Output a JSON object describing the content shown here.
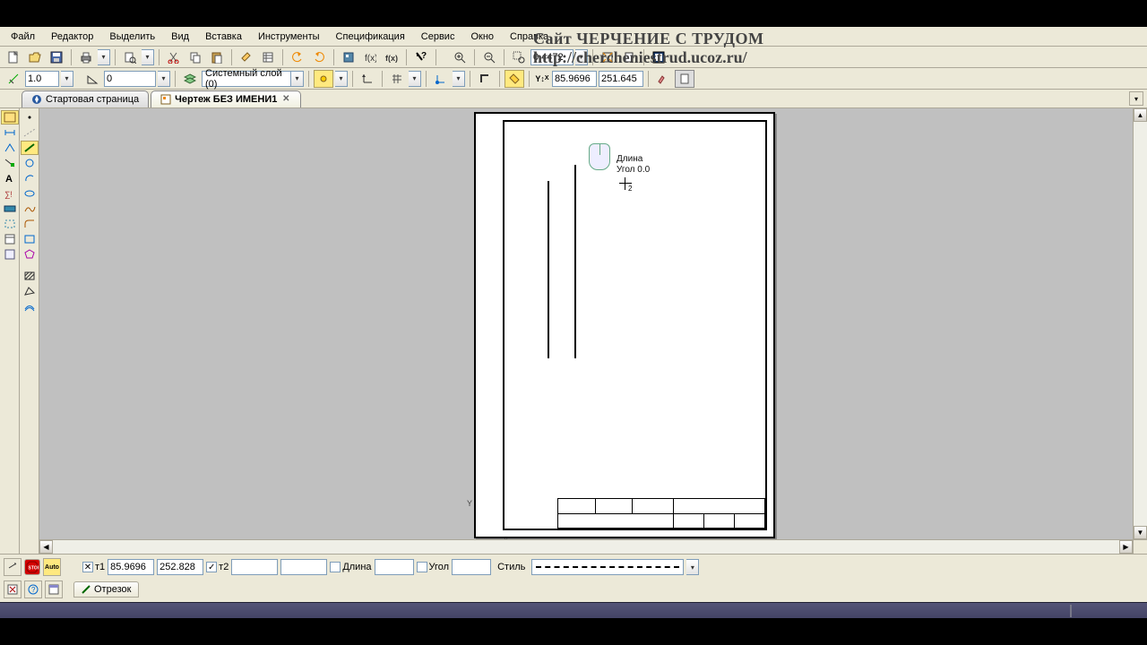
{
  "watermark": {
    "line1": "Сайт ЧЕРЧЕНИЕ С ТРУДОМ",
    "line2": "http://chercheniestrud.ucoz.ru/"
  },
  "menu": {
    "file": "Файл",
    "edit": "Редактор",
    "select": "Выделить",
    "view": "Вид",
    "insert": "Вставка",
    "tools": "Инструменты",
    "spec": "Спецификация",
    "service": "Сервис",
    "window": "Окно",
    "help": "Справка"
  },
  "toolbar1": {
    "zoom_value": "0.4472"
  },
  "toolbar2": {
    "step_value": "1.0",
    "angle_value": "0",
    "layer_label": "Системный слой (0)",
    "coord_x": "85.9696",
    "coord_y": "251.645"
  },
  "tabs": {
    "start": "Стартовая страница",
    "active": "Чертеж БЕЗ ИМЕНИ1"
  },
  "canvas": {
    "tooltip_length": "Длина",
    "tooltip_angle": "Угол 0.0",
    "cursor_sub": "2"
  },
  "props": {
    "t1_label": "т1",
    "t1_x": "85.9696",
    "t1_y": "252.828",
    "t2_label": "т2",
    "t2_x": "",
    "t2_y": "",
    "length_label": "Длина",
    "length_val": "",
    "angle_label": "Угол",
    "angle_val": "",
    "style_label": "Стиль",
    "tab_name": "Отрезок",
    "auto": "Auto"
  }
}
